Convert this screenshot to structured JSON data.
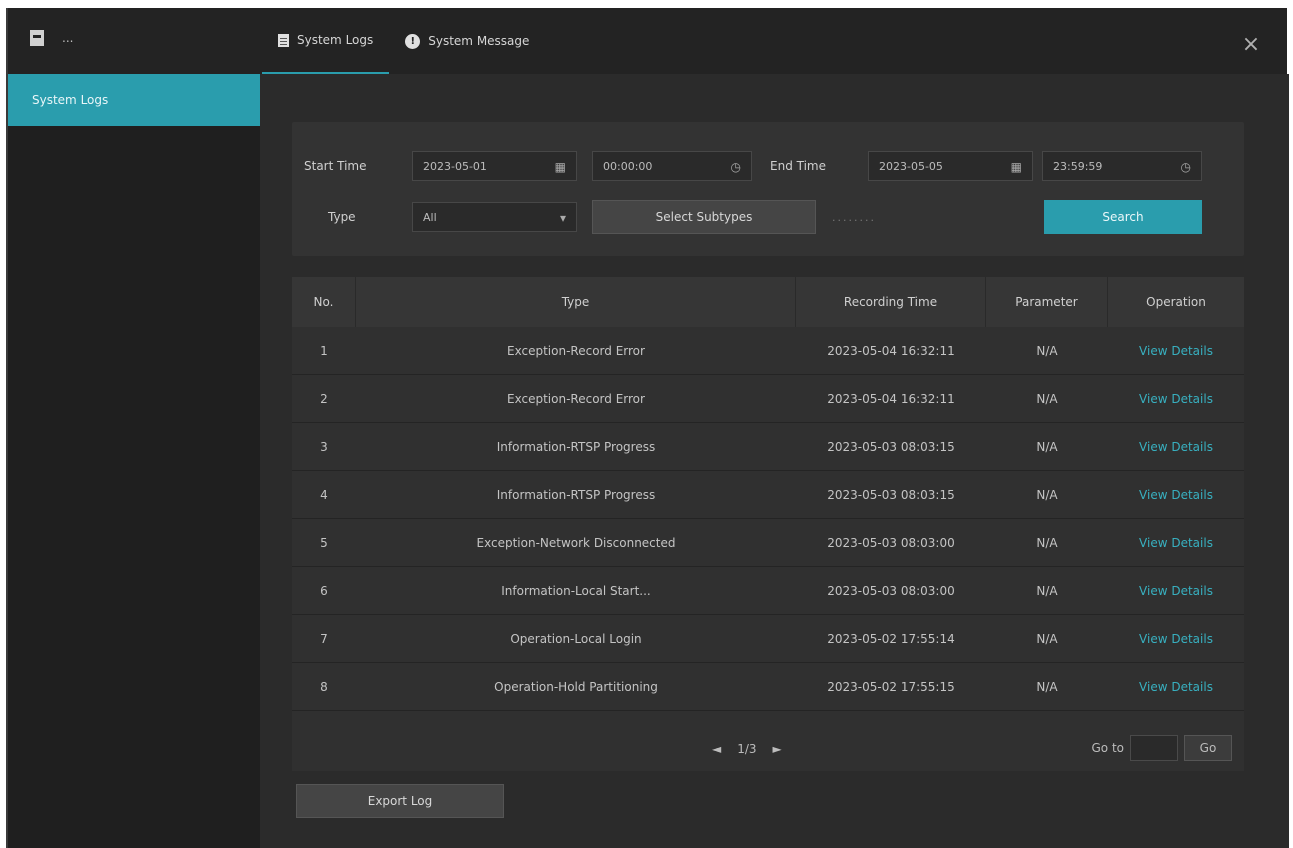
{
  "app": {
    "title": "..."
  },
  "tabs": [
    {
      "label": "System Logs",
      "active": true,
      "icon": "document-icon"
    },
    {
      "label": "System Message",
      "active": false,
      "icon": "info-icon"
    }
  ],
  "sidebar": {
    "items": [
      {
        "label": "System Logs",
        "selected": true
      }
    ]
  },
  "filter": {
    "start_label": "Start Time",
    "start_date": "2023-05-01",
    "start_time": "00:00:00",
    "end_label": "End Time",
    "end_date": "2023-05-05",
    "end_time": "23:59:59",
    "type_label": "Type",
    "type_value": "All",
    "subtypes_button": "Select Subtypes",
    "subtypes_placeholder": "........",
    "search_button": "Search"
  },
  "table": {
    "headers": [
      "No.",
      "Type",
      "Recording Time",
      "Parameter",
      "Operation"
    ],
    "rows": [
      {
        "no": "1",
        "type": "Exception-Record Error",
        "time": "2023-05-04 16:32:11",
        "param": "N/A",
        "op": "View Details"
      },
      {
        "no": "2",
        "type": "Exception-Record Error",
        "time": "2023-05-04 16:32:11",
        "param": "N/A",
        "op": "View Details"
      },
      {
        "no": "3",
        "type": "Information-RTSP Progress",
        "time": "2023-05-03 08:03:15",
        "param": "N/A",
        "op": "View Details"
      },
      {
        "no": "4",
        "type": "Information-RTSP Progress",
        "time": "2023-05-03 08:03:15",
        "param": "N/A",
        "op": "View Details"
      },
      {
        "no": "5",
        "type": "Exception-Network Disconnected",
        "time": "2023-05-03 08:03:00",
        "param": "N/A",
        "op": "View Details"
      },
      {
        "no": "6",
        "type": "Information-Local Start...",
        "time": "2023-05-03 08:03:00",
        "param": "N/A",
        "op": "View Details"
      },
      {
        "no": "7",
        "type": "Operation-Local Login",
        "time": "2023-05-02 17:55:14",
        "param": "N/A",
        "op": "View Details"
      },
      {
        "no": "8",
        "type": "Operation-Hold Partitioning",
        "time": "2023-05-02 17:55:15",
        "param": "N/A",
        "op": "View Details"
      }
    ]
  },
  "pager": {
    "prev": "◄",
    "page": "1/3",
    "next": "►",
    "goto_label": "Go to",
    "goto_button": "Go"
  },
  "export_button": "Export Log"
}
